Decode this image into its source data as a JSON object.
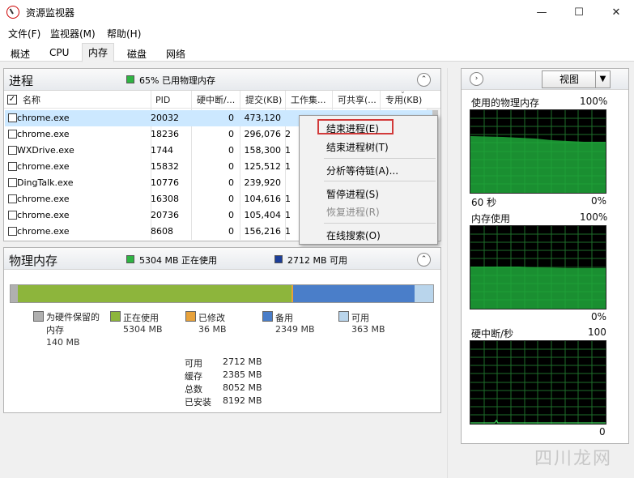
{
  "window": {
    "title": "资源监视器"
  },
  "menu": [
    {
      "label": "文件(F)"
    },
    {
      "label": "监视器(M)"
    },
    {
      "label": "帮助(H)"
    }
  ],
  "tabs": [
    {
      "label": "概述"
    },
    {
      "label": "CPU"
    },
    {
      "label": "内存",
      "active": true
    },
    {
      "label": "磁盘"
    },
    {
      "label": "网络"
    }
  ],
  "process_section": {
    "title": "进程",
    "status": "65% 已用物理内存",
    "status_color": "#2fb443",
    "columns": [
      "名称",
      "PID",
      "硬中断/...",
      "提交(KB)",
      "工作集...",
      "可共享(...",
      "专用(KB)"
    ],
    "rows": [
      {
        "name": "chrome.exe",
        "pid": "20032",
        "hard_faults": "0",
        "commit": "473,120",
        "working_set": "",
        "shareable": "",
        "private": ""
      },
      {
        "name": "chrome.exe",
        "pid": "18236",
        "hard_faults": "0",
        "commit": "296,076",
        "working_set": "2",
        "shareable": "",
        "private": ""
      },
      {
        "name": "WXDrive.exe",
        "pid": "1744",
        "hard_faults": "0",
        "commit": "158,300",
        "working_set": "1",
        "shareable": "",
        "private": ""
      },
      {
        "name": "chrome.exe",
        "pid": "15832",
        "hard_faults": "0",
        "commit": "125,512",
        "working_set": "1",
        "shareable": "",
        "private": ""
      },
      {
        "name": "DingTalk.exe",
        "pid": "10776",
        "hard_faults": "0",
        "commit": "239,920",
        "working_set": "",
        "shareable": "",
        "private": ""
      },
      {
        "name": "chrome.exe",
        "pid": "16308",
        "hard_faults": "0",
        "commit": "104,616",
        "working_set": "1",
        "shareable": "",
        "private": ""
      },
      {
        "name": "chrome.exe",
        "pid": "20736",
        "hard_faults": "0",
        "commit": "105,404",
        "working_set": "1",
        "shareable": "",
        "private": ""
      },
      {
        "name": "chrome.exe",
        "pid": "8608",
        "hard_faults": "0",
        "commit": "156,216",
        "working_set": "1",
        "shareable": "",
        "private": ""
      }
    ]
  },
  "context_menu": {
    "items": [
      {
        "label": "结束进程(E)",
        "highlighted": true
      },
      {
        "label": "结束进程树(T)"
      },
      {
        "label": "分析等待链(A)..."
      },
      {
        "label": "暂停进程(S)"
      },
      {
        "label": "恢复进程(R)",
        "disabled": true
      },
      {
        "label": "在线搜索(O)"
      }
    ]
  },
  "memory_section": {
    "title": "物理内存",
    "in_use_label": "5304 MB 正在使用",
    "available_label": "2712 MB 可用",
    "in_use_color": "#2fb443",
    "available_color": "#1c3e99",
    "bar": [
      {
        "key": "reserved",
        "fraction": 0.017,
        "color": "#b0b0b0"
      },
      {
        "key": "in_use",
        "fraction": 0.6475,
        "color": "#8db53c"
      },
      {
        "key": "modified",
        "fraction": 0.0044,
        "color": "#e8a23b"
      },
      {
        "key": "standby",
        "fraction": 0.2868,
        "color": "#4a7ec9"
      },
      {
        "key": "free",
        "fraction": 0.0443,
        "color": "#b9d5ec"
      }
    ],
    "legend": [
      {
        "label": "为硬件保留的内存",
        "value": "140 MB",
        "color": "#b0b0b0"
      },
      {
        "label": "正在使用",
        "value": "5304 MB",
        "color": "#8db53c"
      },
      {
        "label": "已修改",
        "value": "36 MB",
        "color": "#e8a23b"
      },
      {
        "label": "备用",
        "value": "2349 MB",
        "color": "#4a7ec9"
      },
      {
        "label": "可用",
        "value": "363 MB",
        "color": "#b9d5ec"
      }
    ],
    "stats": [
      {
        "label": "可用",
        "value": "2712 MB"
      },
      {
        "label": "缓存",
        "value": "2385 MB"
      },
      {
        "label": "总数",
        "value": "8052 MB"
      },
      {
        "label": "已安装",
        "value": "8192 MB"
      }
    ]
  },
  "right_panel": {
    "view_button": "视图",
    "graphs": [
      {
        "title": "使用的物理内存",
        "max": "100%",
        "bottom_left": "60 秒",
        "bottom_right": "0%",
        "level": 0.62
      },
      {
        "title": "内存使用",
        "max": "100%",
        "bottom_left": "",
        "bottom_right": "0%",
        "level": 0.5
      },
      {
        "title": "硬中断/秒",
        "max": "100",
        "bottom_left": "",
        "bottom_right": "0",
        "level": 0.0
      }
    ]
  },
  "watermark": "四川龙网"
}
